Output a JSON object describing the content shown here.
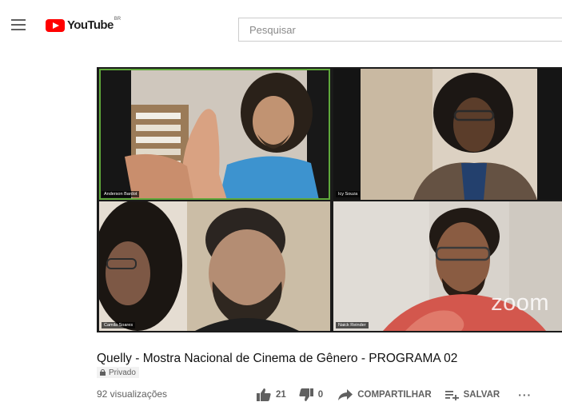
{
  "header": {
    "logo_text": "YouTube",
    "region_code": "BR",
    "search_placeholder": "Pesquisar"
  },
  "video": {
    "participants": [
      {
        "name": "Anderson Bardot"
      },
      {
        "name": "Icy Souza"
      },
      {
        "name": "Camila Soares"
      },
      {
        "name": "Naick Reinder"
      }
    ],
    "watermark": "zoom",
    "title": "Quelly - Mostra Nacional de Cinema de Gênero - PROGRAMA 02",
    "privacy": "Privado",
    "views": "92 visualizações"
  },
  "actions": {
    "like_count": "21",
    "dislike_count": "0",
    "share_label": "COMPARTILHAR",
    "save_label": "SALVAR",
    "more_label": "···"
  },
  "colors": {
    "brand_red": "#ff0000",
    "active_speaker": "#5fa83b",
    "secondary_text": "#606060"
  }
}
